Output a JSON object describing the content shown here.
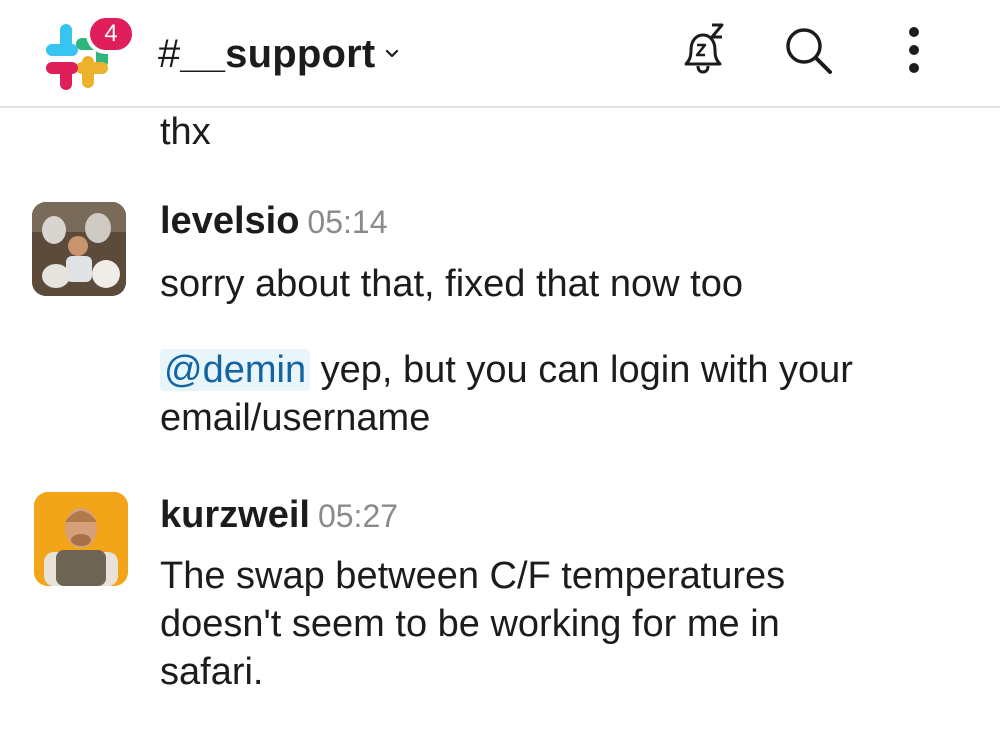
{
  "header": {
    "badge_count": "4",
    "channel_hash": "#",
    "channel_name": "__support"
  },
  "messages": [
    {
      "type": "continuation",
      "text": "thx"
    },
    {
      "author": "levelsio",
      "time": "05:14",
      "lines": [
        "sorry about that, fixed that now too"
      ],
      "mention": "@demin",
      "mention_rest": " yep, but you can login with your email/username"
    },
    {
      "author": "kurzweil",
      "time": "05:27",
      "text": "The swap between C/F temperatures doesn't seem to be working for me in safari."
    }
  ],
  "colors": {
    "badge": "#e01e5a",
    "mention_bg": "#e8f5fa",
    "mention_text": "#1264a3",
    "timestamp": "#8a8a8a"
  }
}
